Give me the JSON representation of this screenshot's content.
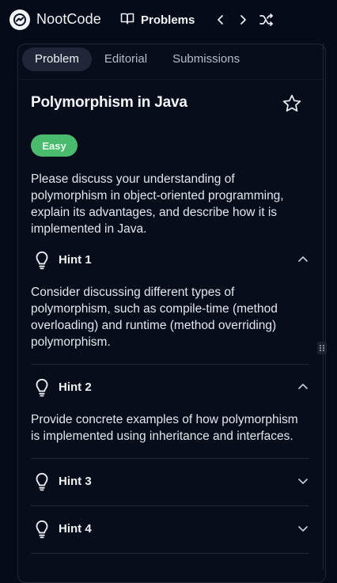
{
  "app": {
    "brand": "NootCode"
  },
  "topbar": {
    "problems_label": "Problems"
  },
  "tabs": [
    {
      "label": "Problem",
      "active": true
    },
    {
      "label": "Editorial",
      "active": false
    },
    {
      "label": "Submissions",
      "active": false
    }
  ],
  "problem": {
    "title": "Polymorphism in Java",
    "difficulty": "Easy",
    "difficulty_color": "#4aba6e",
    "description": "Please discuss your understanding of polymorphism in object-oriented programming, explain its advantages, and describe how it is implemented in Java."
  },
  "hints": [
    {
      "label": "Hint 1",
      "expanded": true,
      "text": "Consider discussing different types of polymorphism, such as compile-time (method overloading) and runtime (method overriding) polymorphism."
    },
    {
      "label": "Hint 2",
      "expanded": true,
      "text": "Provide concrete examples of how polymorphism is implemented using inheritance and interfaces."
    },
    {
      "label": "Hint 3",
      "expanded": false
    },
    {
      "label": "Hint 4",
      "expanded": false
    }
  ],
  "icons": {
    "logo": "nootcode-logo-icon",
    "problems": "book-open-icon",
    "prev": "chevron-left-icon",
    "next": "chevron-right-icon",
    "random": "shuffle-icon",
    "favorite": "star-icon",
    "hint": "lightbulb-icon"
  }
}
